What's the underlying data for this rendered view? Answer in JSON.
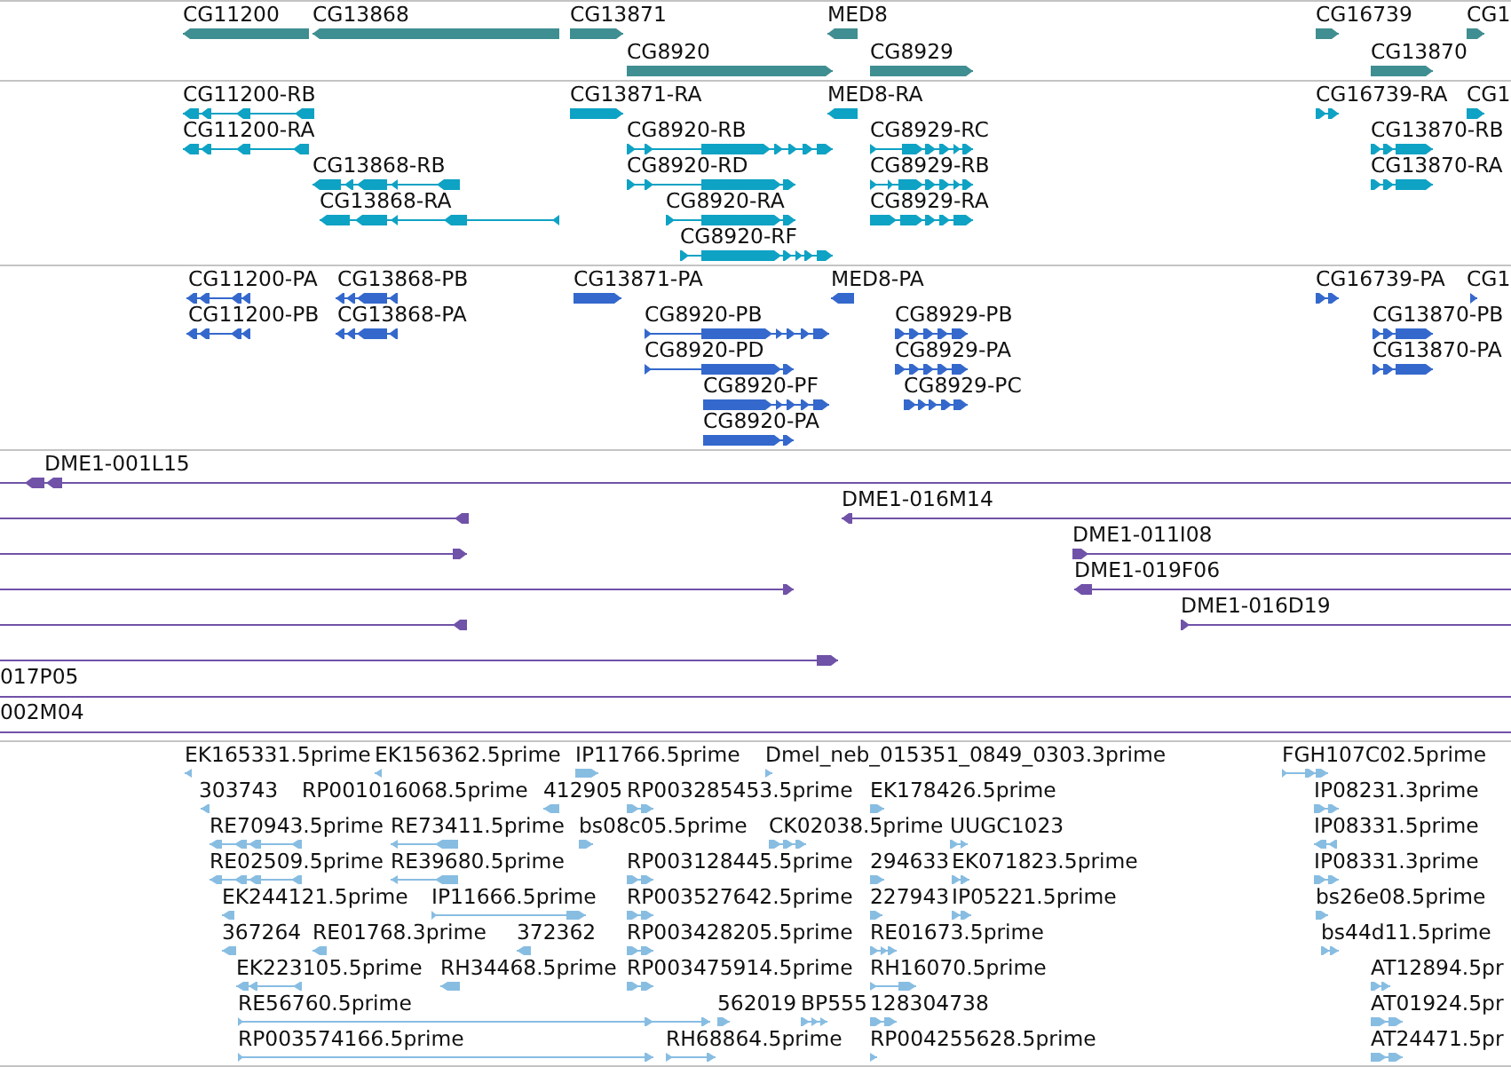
{
  "tracks": [
    {
      "kind": "gene",
      "features": [
        {
          "label": "CG11200",
          "reverse": true
        },
        {
          "label": "CG13868",
          "reverse": true
        },
        {
          "label": "CG13871",
          "reverse": false
        },
        {
          "label": "MED8",
          "reverse": true
        },
        {
          "label": "CG16739",
          "reverse": false
        },
        {
          "label": "CG1",
          "reverse": false
        },
        {
          "label": "CG8920",
          "reverse": false
        },
        {
          "label": "CG8929",
          "reverse": false
        },
        {
          "label": "CG13870",
          "reverse": false
        }
      ]
    },
    {
      "kind": "transcript",
      "features": [
        {
          "label": "CG11200-RB",
          "reverse": true
        },
        {
          "label": "CG13871-RA",
          "reverse": false
        },
        {
          "label": "MED8-RA",
          "reverse": true
        },
        {
          "label": "CG16739-RA",
          "reverse": false
        },
        {
          "label": "CG1",
          "reverse": false
        },
        {
          "label": "CG11200-RA",
          "reverse": true
        },
        {
          "label": "CG8920-RB",
          "reverse": false
        },
        {
          "label": "CG8929-RC",
          "reverse": false
        },
        {
          "label": "CG13870-RB",
          "reverse": false
        },
        {
          "label": "CG13868-RB",
          "reverse": true
        },
        {
          "label": "CG8920-RD",
          "reverse": false
        },
        {
          "label": "CG8929-RB",
          "reverse": false
        },
        {
          "label": "CG13870-RA",
          "reverse": false
        },
        {
          "label": "CG13868-RA",
          "reverse": true
        },
        {
          "label": "CG8920-RA",
          "reverse": false
        },
        {
          "label": "CG8929-RA",
          "reverse": false
        },
        {
          "label": "CG8920-RF",
          "reverse": false
        }
      ]
    },
    {
      "kind": "protein",
      "features": [
        {
          "label": "CG11200-PA",
          "reverse": true
        },
        {
          "label": "CG13868-PB",
          "reverse": true
        },
        {
          "label": "CG13871-PA",
          "reverse": false
        },
        {
          "label": "MED8-PA",
          "reverse": true
        },
        {
          "label": "CG16739-PA",
          "reverse": false
        },
        {
          "label": "CG1",
          "reverse": false
        },
        {
          "label": "CG11200-PB",
          "reverse": true
        },
        {
          "label": "CG13868-PA",
          "reverse": true
        },
        {
          "label": "CG8920-PB",
          "reverse": false
        },
        {
          "label": "CG8929-PB",
          "reverse": false
        },
        {
          "label": "CG13870-PB",
          "reverse": false
        },
        {
          "label": "CG8920-PD",
          "reverse": false
        },
        {
          "label": "CG8929-PA",
          "reverse": false
        },
        {
          "label": "CG13870-PA",
          "reverse": false
        },
        {
          "label": "CG8920-PF",
          "reverse": false
        },
        {
          "label": "CG8929-PC",
          "reverse": false
        },
        {
          "label": "CG8920-PA",
          "reverse": false
        }
      ]
    },
    {
      "kind": "clone",
      "features": [
        {
          "label": "DME1-001L15",
          "reverse": true
        },
        {
          "reverse": true
        },
        {
          "label": "DME1-016M14",
          "reverse": true
        },
        {
          "reverse": false
        },
        {
          "label": "DME1-011I08",
          "reverse": false
        },
        {
          "reverse": false
        },
        {
          "label": "DME1-019F06",
          "reverse": true
        },
        {
          "reverse": true
        },
        {
          "label": "DME1-016D19",
          "reverse": false
        },
        {
          "reverse": false
        },
        {
          "label": "017P05"
        },
        {
          "label": "002M04"
        }
      ]
    },
    {
      "kind": "est",
      "features": [
        {
          "label": "EK165331.5prime",
          "reverse": true
        },
        {
          "label": "EK156362.5prime",
          "reverse": true
        },
        {
          "label": "IP11766.5prime",
          "reverse": false
        },
        {
          "label": "Dmel_neb_015351_0849_0303.3prime",
          "reverse": false
        },
        {
          "label": "FGH107C02.5prime",
          "reverse": false
        },
        {
          "label": "303743",
          "reverse": true
        },
        {
          "label": "RP001016068.5prime"
        },
        {
          "label": "412905",
          "reverse": true
        },
        {
          "label": "RP003285453.5prime",
          "reverse": false
        },
        {
          "label": "EK178426.5prime",
          "reverse": false
        },
        {
          "label": "IP08231.3prime",
          "reverse": false
        },
        {
          "label": "RE70943.5prime",
          "reverse": true
        },
        {
          "label": "RE73411.5prime",
          "reverse": true
        },
        {
          "label": "bs08c05.5prime",
          "reverse": false
        },
        {
          "label": "CK02038.5prime",
          "reverse": false
        },
        {
          "label": "UUGC1023",
          "reverse": false
        },
        {
          "label": "IP08331.5prime",
          "reverse": true
        },
        {
          "label": "RE02509.5prime",
          "reverse": true
        },
        {
          "label": "RE39680.5prime",
          "reverse": true
        },
        {
          "label": "RP003128445.5prime",
          "reverse": false
        },
        {
          "label": "294633",
          "reverse": false
        },
        {
          "label": "EK071823.5prime",
          "reverse": false
        },
        {
          "label": "IP08331.3prime",
          "reverse": false
        },
        {
          "label": "EK244121.5prime",
          "reverse": true
        },
        {
          "label": "IP11666.5prime",
          "reverse": false
        },
        {
          "label": "RP003527642.5prime",
          "reverse": false
        },
        {
          "label": "227943",
          "reverse": false
        },
        {
          "label": "IP05221.5prime",
          "reverse": false
        },
        {
          "label": "bs26e08.5prime",
          "reverse": false
        },
        {
          "label": "367264",
          "reverse": true
        },
        {
          "label": "RE01768.3prime",
          "reverse": true
        },
        {
          "label": "372362",
          "reverse": true
        },
        {
          "label": "RP003428205.5prime",
          "reverse": false
        },
        {
          "label": "RE01673.5prime",
          "reverse": false
        },
        {
          "label": "bs44d11.5prime",
          "reverse": false
        },
        {
          "label": "EK223105.5prime",
          "reverse": true
        },
        {
          "label": "RH34468.5prime",
          "reverse": true
        },
        {
          "label": "RP003475914.5prime",
          "reverse": false
        },
        {
          "label": "RH16070.5prime",
          "reverse": false
        },
        {
          "label": "AT12894.5pr",
          "reverse": false
        },
        {
          "label": "RE56760.5prime",
          "reverse": false
        },
        {
          "label": "562019",
          "reverse": false
        },
        {
          "label": "BP555",
          "reverse": false
        },
        {
          "label": "128304738",
          "reverse": false
        },
        {
          "label": "AT01924.5pr",
          "reverse": false
        },
        {
          "label": "RP003574166.5prime",
          "reverse": false
        },
        {
          "label": "RH68864.5prime",
          "reverse": false
        },
        {
          "label": "RP004255628.5prime",
          "reverse": false
        },
        {
          "label": "AT24471.5pr",
          "reverse": false
        }
      ]
    }
  ]
}
